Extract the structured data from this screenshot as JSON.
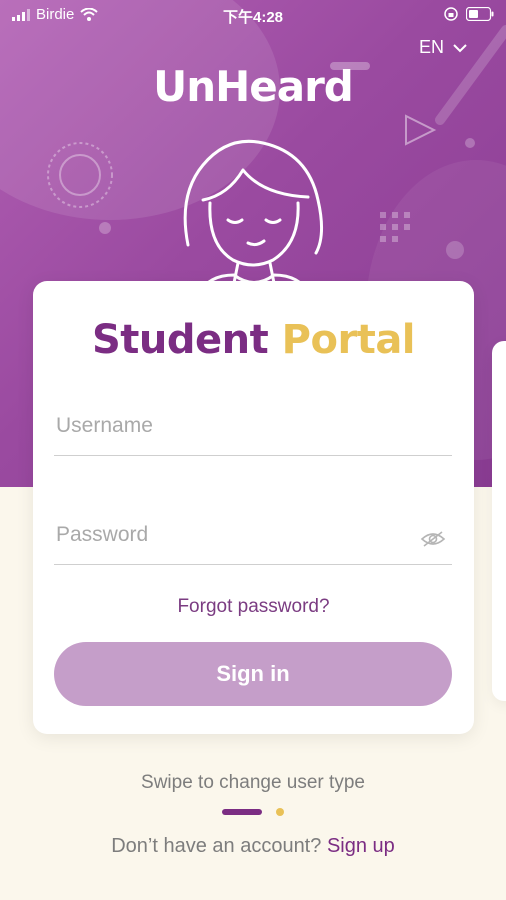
{
  "status_bar": {
    "carrier": "Birdie",
    "time": "下午4:28"
  },
  "header": {
    "language": "EN",
    "logo_text": "UnHeard"
  },
  "login_card": {
    "title_part1": "Student",
    "title_part2": "Portal",
    "username_placeholder": "Username",
    "password_placeholder": "Password",
    "forgot_password": "Forgot password?",
    "sign_in_button": "Sign in"
  },
  "footer": {
    "swipe_hint": "Swipe to change user type",
    "no_account_text": "Don’t have an account?",
    "sign_up_link": "Sign up"
  },
  "colors": {
    "brand_purple": "#7b2d83",
    "brand_yellow": "#e9c157",
    "hero_purple": "#9a4aa0",
    "button_disabled": "#c59ec9",
    "background": "#fbf7ec"
  },
  "pagination": {
    "total": 2,
    "active": 1
  },
  "icons": [
    "signal-icon",
    "wifi-icon",
    "lock-rotation-icon",
    "battery-icon",
    "chevron-down-icon",
    "eye-icon",
    "avatar-illustration"
  ]
}
